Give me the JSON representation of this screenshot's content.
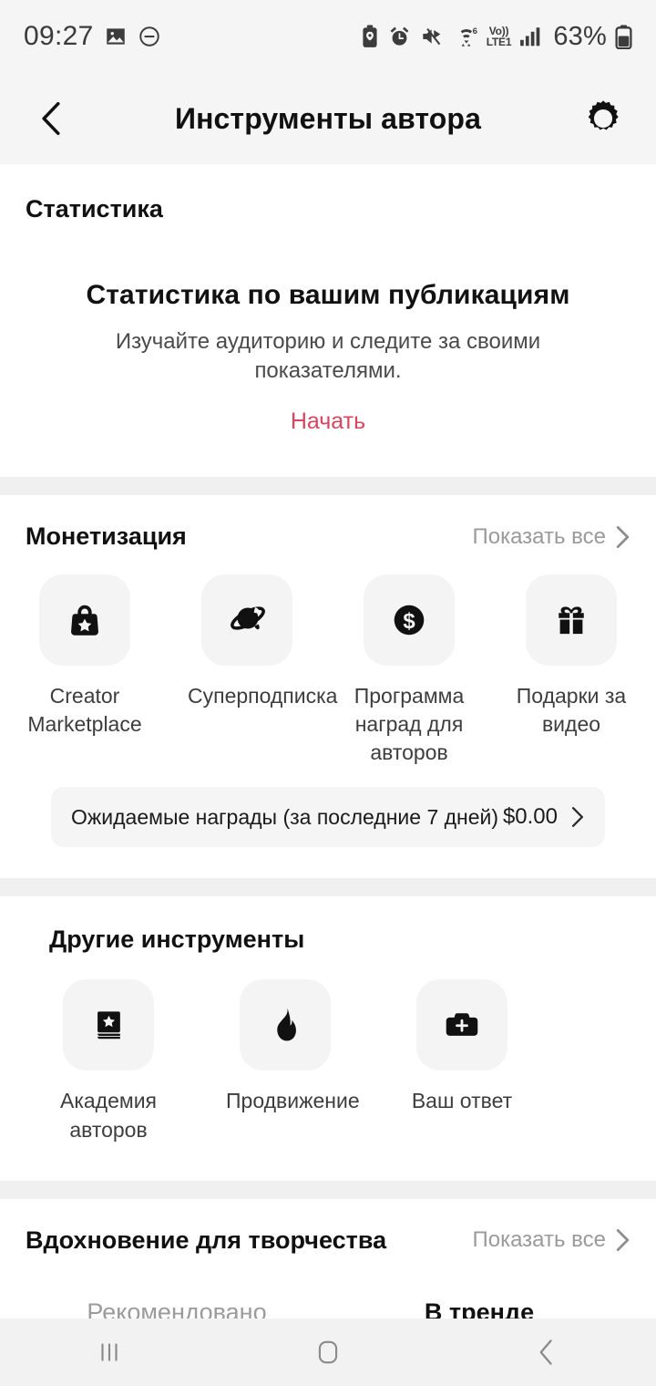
{
  "status_bar": {
    "time": "09:27",
    "battery_percent": "63%",
    "network": {
      "volte_top": "Vo))",
      "volte_bottom": "LTE1",
      "wifi_badge": "6"
    },
    "icons": [
      "image-icon",
      "do-not-disturb-icon",
      "battery-saver-icon",
      "alarm-icon",
      "mute-icon",
      "wifi-icon",
      "volte-icon",
      "signal-icon",
      "battery-icon"
    ]
  },
  "app_bar": {
    "title": "Инструменты автора",
    "back_icon": "chevron-left-icon",
    "settings_icon": "gear-icon"
  },
  "statistics": {
    "section_label": "Статистика",
    "empty_title": "Статистика по вашим публикациям",
    "empty_subtitle": "Изучайте аудиторию и следите за своими показателями.",
    "cta_label": "Начать",
    "cta_color": "#d9455f"
  },
  "monetization": {
    "section_label": "Монетизация",
    "see_all_label": "Показать все",
    "tiles": [
      {
        "label": "Creator Marketplace",
        "icon": "shopping-bag-star-icon"
      },
      {
        "label": "Суперподписка",
        "icon": "planet-icon"
      },
      {
        "label": "Программа наград для авторов",
        "icon": "dollar-coin-icon"
      },
      {
        "label": "Подарки за видео",
        "icon": "gift-icon"
      }
    ],
    "rewards": {
      "label": "Ожидаемые награды (за последние 7 дней)",
      "value": "$0.00",
      "chevron_icon": "chevron-right-icon"
    }
  },
  "other_tools": {
    "section_label": "Другие инструменты",
    "tiles": [
      {
        "label": "Академия авторов",
        "icon": "book-star-icon"
      },
      {
        "label": "Продвижение",
        "icon": "flame-icon"
      },
      {
        "label": "Ваш ответ",
        "icon": "camera-plus-icon"
      }
    ]
  },
  "inspiration": {
    "section_label": "Вдохновение для творчества",
    "see_all_label": "Показать все",
    "tabs": [
      {
        "label": "Рекомендовано",
        "active": false
      },
      {
        "label": "В тренде",
        "active": true
      }
    ]
  },
  "nav_bar": {
    "recents_icon": "recents-icon",
    "home_icon": "home-icon",
    "back_icon": "back-icon"
  }
}
